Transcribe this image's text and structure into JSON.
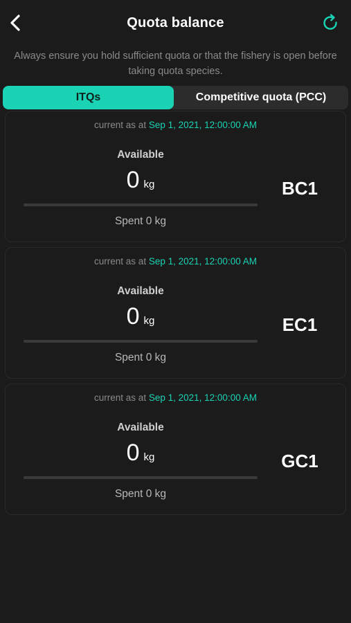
{
  "header": {
    "title": "Quota balance",
    "back_icon": "chevron-left-icon",
    "refresh_icon": "refresh-icon",
    "accent_color": "#19d3b4"
  },
  "notice": "Always ensure you hold sufficient quota or that the fishery is open before taking quota species.",
  "tabs": [
    {
      "label": "ITQs",
      "active": true
    },
    {
      "label": "Competitive quota (PCC)",
      "active": false
    }
  ],
  "cards": [
    {
      "asof_prefix": "current as at",
      "asof_date": "Sep 1, 2021, 12:00:00 AM",
      "available_label": "Available",
      "available_value": "0",
      "available_unit": "kg",
      "spent_text": "Spent 0 kg",
      "code": "BC1",
      "progress_fraction": 0
    },
    {
      "asof_prefix": "current as at",
      "asof_date": "Sep 1, 2021, 12:00:00 AM",
      "available_label": "Available",
      "available_value": "0",
      "available_unit": "kg",
      "spent_text": "Spent 0 kg",
      "code": "EC1",
      "progress_fraction": 0
    },
    {
      "asof_prefix": "current as at",
      "asof_date": "Sep 1, 2021, 12:00:00 AM",
      "available_label": "Available",
      "available_value": "0",
      "available_unit": "kg",
      "spent_text": "Spent 0 kg",
      "code": "GC1",
      "progress_fraction": 0
    }
  ]
}
